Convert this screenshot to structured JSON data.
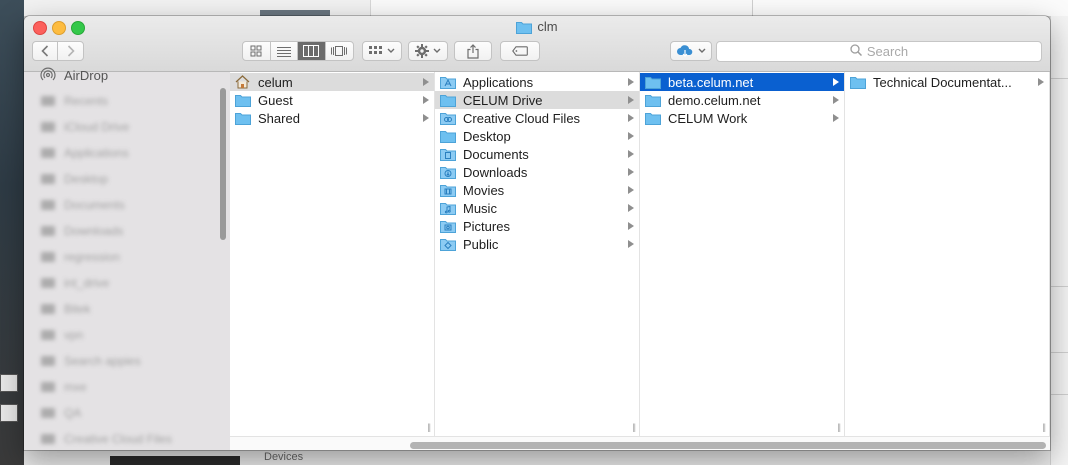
{
  "window": {
    "title": "clm"
  },
  "toolbar": {
    "search_placeholder": "Search"
  },
  "sidebar": {
    "airdrop_label": "AirDrop",
    "items": [
      {
        "label": "Recents",
        "icon": "clock-icon"
      },
      {
        "label": "iCloud Drive",
        "icon": "cloud-icon"
      },
      {
        "label": "Applications",
        "icon": "applications-icon"
      },
      {
        "label": "Desktop",
        "icon": "desktop-icon"
      },
      {
        "label": "Documents",
        "icon": "documents-icon"
      },
      {
        "label": "Downloads",
        "icon": "downloads-icon"
      },
      {
        "label": "regression",
        "icon": "folder-icon"
      },
      {
        "label": "int_drive",
        "icon": "folder-icon"
      },
      {
        "label": "Bitek",
        "icon": "folder-icon"
      },
      {
        "label": "vpn",
        "icon": "folder-icon"
      },
      {
        "label": "Search appies",
        "icon": "gear-icon"
      },
      {
        "label": "mxe",
        "icon": "folder-icon"
      },
      {
        "label": "QA",
        "icon": "folder-icon"
      },
      {
        "label": "Creative Cloud Files",
        "icon": "folder-icon"
      }
    ]
  },
  "columns": [
    {
      "items": [
        {
          "label": "celum",
          "icon": "home-icon",
          "state": "selected-inactive"
        },
        {
          "label": "Guest",
          "icon": "folder-icon",
          "state": "normal"
        },
        {
          "label": "Shared",
          "icon": "folder-icon",
          "state": "normal"
        }
      ]
    },
    {
      "items": [
        {
          "label": "Applications",
          "icon": "applications-folder-icon",
          "state": "normal"
        },
        {
          "label": "CELUM Drive",
          "icon": "folder-icon",
          "state": "selected-inactive"
        },
        {
          "label": "Creative Cloud Files",
          "icon": "creative-cloud-folder-icon",
          "state": "normal"
        },
        {
          "label": "Desktop",
          "icon": "folder-icon",
          "state": "normal"
        },
        {
          "label": "Documents",
          "icon": "documents-folder-icon",
          "state": "normal"
        },
        {
          "label": "Downloads",
          "icon": "downloads-folder-icon",
          "state": "normal"
        },
        {
          "label": "Movies",
          "icon": "movies-folder-icon",
          "state": "normal"
        },
        {
          "label": "Music",
          "icon": "music-folder-icon",
          "state": "normal"
        },
        {
          "label": "Pictures",
          "icon": "pictures-folder-icon",
          "state": "normal"
        },
        {
          "label": "Public",
          "icon": "public-folder-icon",
          "state": "normal"
        }
      ]
    },
    {
      "items": [
        {
          "label": "beta.celum.net",
          "icon": "folder-icon",
          "state": "selected-active"
        },
        {
          "label": "demo.celum.net",
          "icon": "folder-icon",
          "state": "normal"
        },
        {
          "label": "CELUM Work",
          "icon": "folder-icon",
          "state": "normal"
        }
      ]
    },
    {
      "items": [
        {
          "label": "Technical Documentat...",
          "icon": "folder-icon",
          "state": "normal"
        }
      ]
    }
  ],
  "background": {
    "devices_label": "Devices"
  },
  "colors": {
    "selection_blue": "#0a60d0",
    "selection_gray": "#dcdcdc",
    "folder_blue": "#6ec0f0",
    "close_red": "#fc605c",
    "minimize_yellow": "#fdbc40",
    "zoom_green": "#34c84a"
  }
}
